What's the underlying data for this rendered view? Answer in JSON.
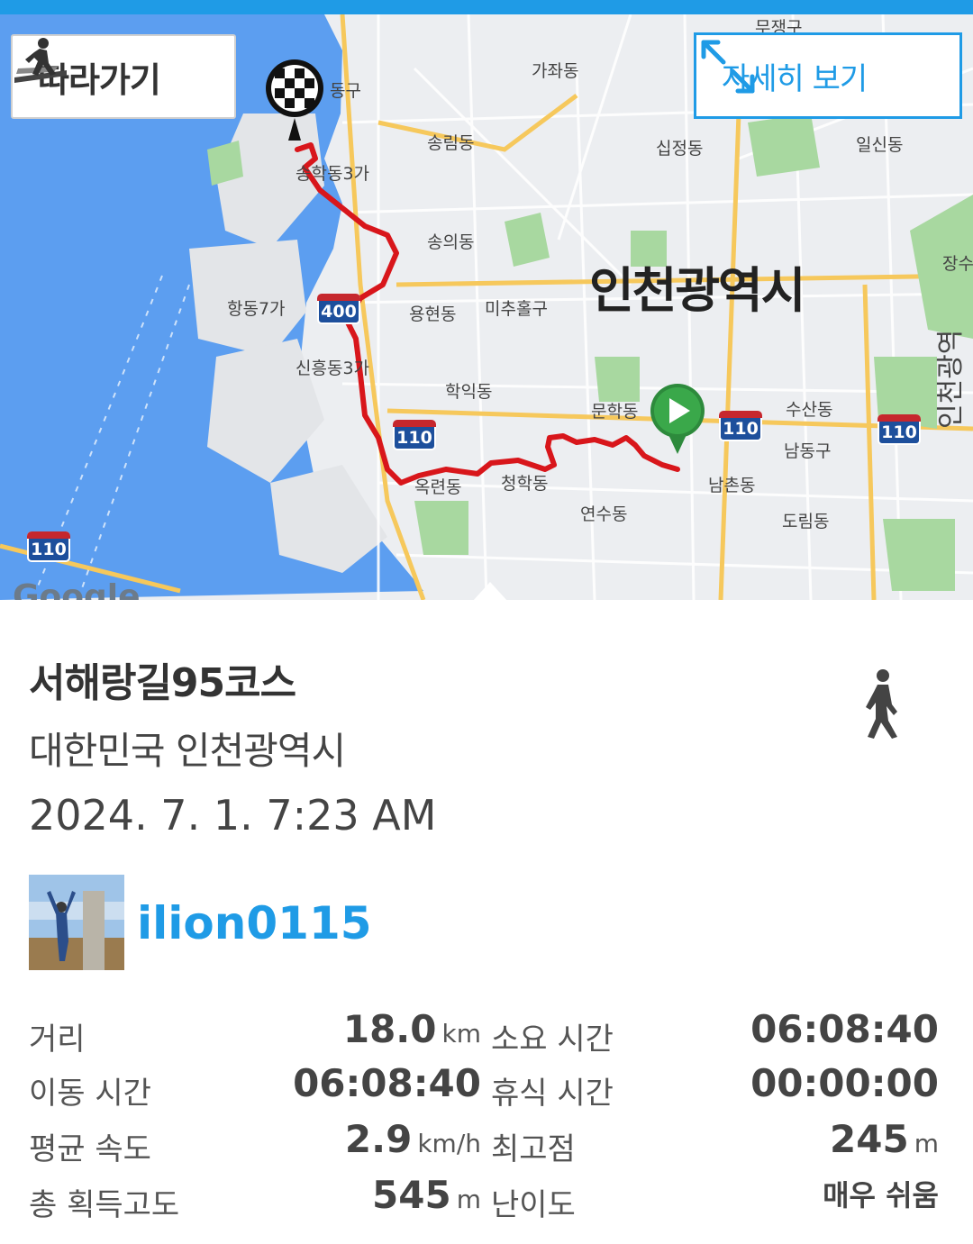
{
  "map": {
    "follow_label": "따라가기",
    "detail_label": "자세히 보기",
    "city_label": "인천광역시",
    "attribution": "Google",
    "labels": [
      "무쟁구",
      "가좌동",
      "동구",
      "송림동",
      "십정동",
      "일신동",
      "송학동3가",
      "송의동",
      "장수",
      "항동7가",
      "용현동",
      "미추홀구",
      "신흥동3가",
      "학익동",
      "문학동",
      "수산동",
      "남동구",
      "옥련동",
      "청학동",
      "남촌동",
      "연수동",
      "도림동",
      "인천광역"
    ],
    "shields": [
      "400",
      "110",
      "110",
      "110",
      "110"
    ]
  },
  "course": {
    "title": "서해랑길95코스",
    "location": "대한민국 인천광역시",
    "datetime": "2024. 7. 1. 7:23 AM",
    "activity_icon": "walking-person-icon"
  },
  "user": {
    "name": "ilion0115"
  },
  "stats": [
    {
      "label": "거리",
      "value": "18.0",
      "unit": "km",
      "label2": "소요 시간",
      "value2": "06:08:40",
      "unit2": ""
    },
    {
      "label": "이동 시간",
      "value": "06:08:40",
      "unit": "",
      "label2": "휴식 시간",
      "value2": "00:00:00",
      "unit2": ""
    },
    {
      "label": "평균 속도",
      "value": "2.9",
      "unit": "km/h",
      "label2": "최고점",
      "value2": "245",
      "unit2": "m"
    },
    {
      "label": "총 획득고도",
      "value": "545",
      "unit": "m",
      "label2": "난이도",
      "value2": "매우 쉬움",
      "unit2": ""
    }
  ],
  "colors": {
    "accent": "#1f9be6",
    "route": "#d8161b",
    "water": "#5c9ef0",
    "park": "#a8d8a0",
    "start_marker": "#3aa84a"
  }
}
